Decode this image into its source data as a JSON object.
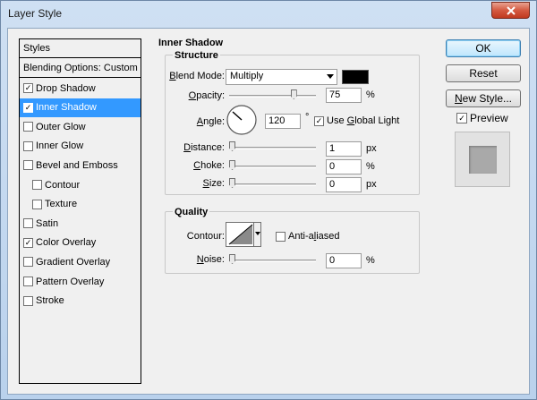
{
  "window": {
    "title": "Layer Style"
  },
  "styles_panel": {
    "header": "Styles",
    "blending": "Blending Options: Custom",
    "items": [
      {
        "label": "Drop Shadow",
        "checked": true,
        "selected": false,
        "indent": false
      },
      {
        "label": "Inner Shadow",
        "checked": true,
        "selected": true,
        "indent": false
      },
      {
        "label": "Outer Glow",
        "checked": false,
        "selected": false,
        "indent": false
      },
      {
        "label": "Inner Glow",
        "checked": false,
        "selected": false,
        "indent": false
      },
      {
        "label": "Bevel and Emboss",
        "checked": false,
        "selected": false,
        "indent": false
      },
      {
        "label": "Contour",
        "checked": false,
        "selected": false,
        "indent": true
      },
      {
        "label": "Texture",
        "checked": false,
        "selected": false,
        "indent": true
      },
      {
        "label": "Satin",
        "checked": false,
        "selected": false,
        "indent": false
      },
      {
        "label": "Color Overlay",
        "checked": true,
        "selected": false,
        "indent": false
      },
      {
        "label": "Gradient Overlay",
        "checked": false,
        "selected": false,
        "indent": false
      },
      {
        "label": "Pattern Overlay",
        "checked": false,
        "selected": false,
        "indent": false
      },
      {
        "label": "Stroke",
        "checked": false,
        "selected": false,
        "indent": false
      }
    ]
  },
  "inner_shadow": {
    "title": "Inner Shadow",
    "structure": {
      "title": "Structure",
      "blend_mode_label": "Blend Mode:",
      "blend_mode_value": "Multiply",
      "color": "#000000",
      "opacity_label": "Opacity:",
      "opacity_value": "75",
      "opacity_unit": "%",
      "opacity_level": 0.75,
      "angle_label": "Angle:",
      "angle_value": "120",
      "angle_unit": "°",
      "use_global_light_label": "Use Global Light",
      "use_global_light": true,
      "distance_label": "Distance:",
      "distance_value": "1",
      "distance_unit": "px",
      "choke_label": "Choke:",
      "choke_value": "0",
      "choke_unit": "%",
      "size_label": "Size:",
      "size_value": "0",
      "size_unit": "px"
    },
    "quality": {
      "title": "Quality",
      "contour_label": "Contour:",
      "anti_aliased_label": "Anti-aliased",
      "anti_aliased": false,
      "noise_label": "Noise:",
      "noise_value": "0",
      "noise_unit": "%"
    }
  },
  "buttons": {
    "ok": "OK",
    "reset": "Reset",
    "new_style": "New Style...",
    "preview_label": "Preview",
    "preview_checked": true
  },
  "icons": {
    "close": "close-icon",
    "check": "check-icon",
    "dropdown": "chevron-down-icon"
  }
}
